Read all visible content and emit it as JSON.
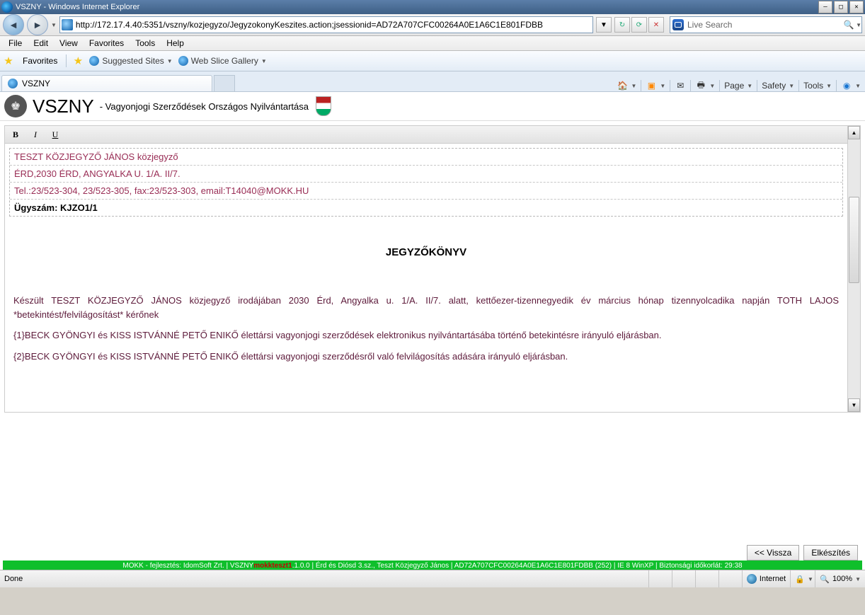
{
  "window": {
    "title": "VSZNY - Windows Internet Explorer"
  },
  "nav": {
    "url": "http://172.17.4.40:5351/vszny/kozjegyzo/JegyzokonyKeszites.action;jsessionid=AD72A707CFC00264A0E1A6C1E801FDBB",
    "search_placeholder": "Live Search"
  },
  "menu": [
    "File",
    "Edit",
    "View",
    "Favorites",
    "Tools",
    "Help"
  ],
  "fav": {
    "label": "Favorites",
    "suggested": "Suggested Sites",
    "webslice": "Web Slice Gallery"
  },
  "tab": {
    "title": "VSZNY"
  },
  "cmd": {
    "page": "Page",
    "safety": "Safety",
    "tools": "Tools"
  },
  "app": {
    "title": "VSZNY",
    "subtitle": "- Vagyonjogi Szerződések Országos Nyilvántartása"
  },
  "header_rows": [
    "TESZT KÖZJEGYZŐ JÁNOS közjegyző",
    "ÉRD,2030 ÉRD, ANGYALKA U. 1/A. II/7.",
    "Tel.:23/523-304, 23/523-305, fax:23/523-303, email:T14040@MOKK.HU",
    "Ügyszám: KJZO1/1"
  ],
  "doc": {
    "heading": "JEGYZŐKÖNYV",
    "p1": "Készült TESZT KÖZJEGYZŐ JÁNOS közjegyző irodájában 2030 Érd, Angyalka u. 1/A. II/7. alatt, kettőezer-tizennegyedik év március hónap tizennyolcadika napján TOTH LAJOS *betekintést/felvilágosítást* kérőnek",
    "p2": "{1}BECK GYÖNGYI és KISS ISTVÁNNÉ PETŐ ENIKŐ élettársi vagyonjogi szerződések elektronikus nyilvántartásába történő betekintésre irányuló eljárásban.",
    "p3": "{2}BECK GYÖNGYI és KISS ISTVÁNNÉ PETŐ ENIKŐ élettársi vagyonjogi szerződésről való felvilágosítás adására irányuló eljárásban."
  },
  "buttons": {
    "back": "<< Vissza",
    "make": "Elkészítés"
  },
  "footer": {
    "pre": "MOKK - fejlesztés: IdomSoft Zrt.  |  VSZNY ",
    "env": "mokkteszt1",
    "post": ".1.0.0  |  Érd és Diósd 3.sz., Teszt Közjegyző János  |  AD72A707CFC00264A0E1A6C1E801FDBB (252)  |  IE 8 WinXP  |  Biztonsági időkorlát:  29:38"
  },
  "status": {
    "done": "Done",
    "zone": "Internet",
    "zoom": "100%"
  }
}
